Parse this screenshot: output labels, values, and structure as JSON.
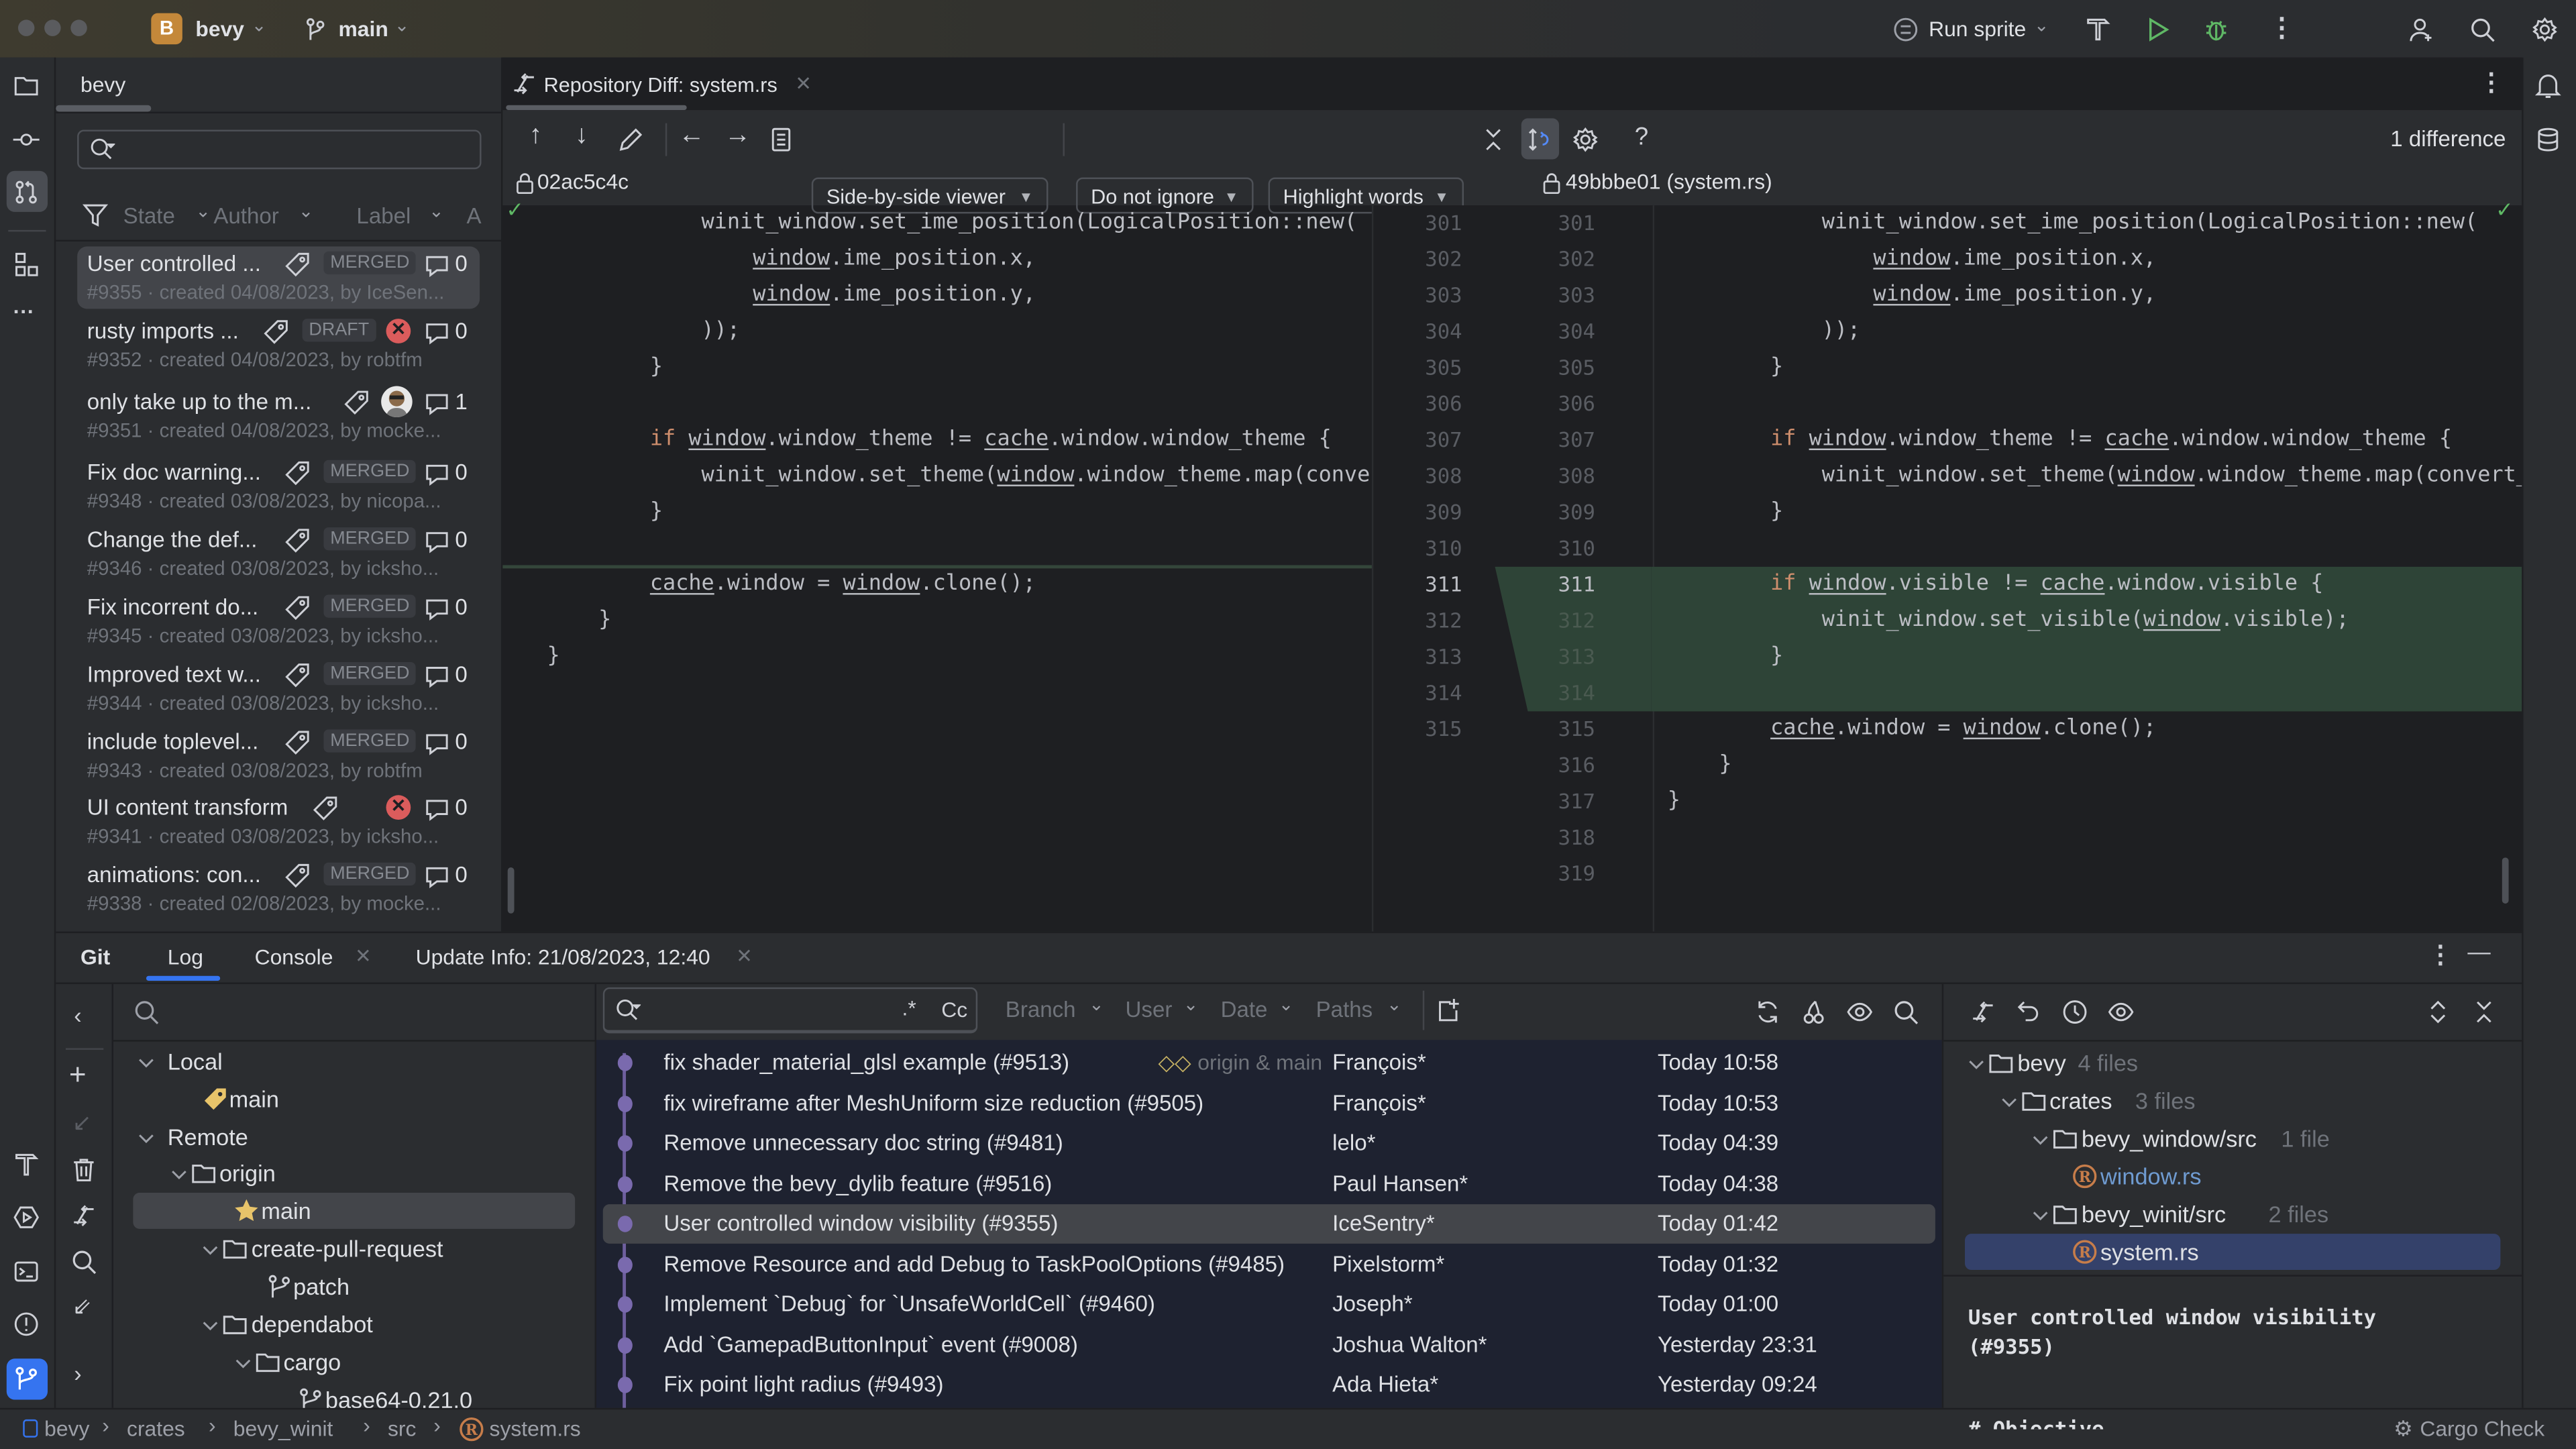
{
  "titlebar": {
    "project_badge": "B",
    "project": "bevy",
    "branch": "main",
    "run_config": "Run sprite"
  },
  "pr_panel": {
    "tab": "bevy",
    "search_placeholder": "",
    "filters": [
      "State",
      "Author",
      "Label",
      "A"
    ],
    "items": [
      {
        "title": "User controlled ...",
        "meta": "#9355 · created 04/08/2023, by IceSen...",
        "state": "MERGED",
        "status": "",
        "comments": "0",
        "selected": true
      },
      {
        "title": "rusty imports ...",
        "meta": "#9352 · created 04/08/2023, by robtfm",
        "state": "DRAFT",
        "status": "failed",
        "comments": "0"
      },
      {
        "title": "only take up to the m...",
        "meta": "#9351 · created 04/08/2023, by mocke...",
        "state": "",
        "status": "avatar",
        "comments": "1"
      },
      {
        "title": "Fix doc warning...",
        "meta": "#9348 · created 03/08/2023, by nicopa...",
        "state": "MERGED",
        "status": "",
        "comments": "0"
      },
      {
        "title": "Change the def...",
        "meta": "#9346 · created 03/08/2023, by icksho...",
        "state": "MERGED",
        "status": "",
        "comments": "0"
      },
      {
        "title": "Fix incorrent do...",
        "meta": "#9345 · created 03/08/2023, by ickshо...",
        "state": "MERGED",
        "status": "",
        "comments": "0"
      },
      {
        "title": "Improved text w...",
        "meta": "#9344 · created 03/08/2023, by ickshо...",
        "state": "MERGED",
        "status": "",
        "comments": "0"
      },
      {
        "title": "include toplevel...",
        "meta": "#9343 · created 03/08/2023, by robtfm",
        "state": "MERGED",
        "status": "",
        "comments": "0"
      },
      {
        "title": "UI content transform",
        "meta": "#9341 · created 03/08/2023, by ickshо...",
        "state": "",
        "status": "failed",
        "comments": "0"
      },
      {
        "title": "animations: con...",
        "meta": "#9338 · created 02/08/2023, by mocke...",
        "state": "MERGED",
        "status": "",
        "comments": "0"
      }
    ]
  },
  "editor": {
    "tab": "Repository Diff: system.rs",
    "viewer": "Side-by-side viewer",
    "ignore": "Do not ignore",
    "highlight": "Highlight words",
    "differences": "1 difference",
    "left_rev": "02ac5c4c",
    "right_rev": "49bbbe01 (system.rs)",
    "left_lines": [
      {
        "n": "301",
        "text": "            winit_window.set_ime_position(LogicalPosition::new("
      },
      {
        "n": "302",
        "text": "                window.ime_position.x,"
      },
      {
        "n": "303",
        "text": "                window.ime_position.y,"
      },
      {
        "n": "304",
        "text": "            ));"
      },
      {
        "n": "305",
        "text": "        }"
      },
      {
        "n": "306",
        "text": ""
      },
      {
        "n": "307",
        "text": "        if window.window_theme != cache.window.window_theme {"
      },
      {
        "n": "308",
        "text": "            winit_window.set_theme(window.window_theme.map(conve"
      },
      {
        "n": "309",
        "text": "        }"
      },
      {
        "n": "310",
        "text": ""
      },
      {
        "n": "311",
        "text": "        cache.window = window.clone();"
      },
      {
        "n": "312",
        "text": "    }"
      },
      {
        "n": "313",
        "text": "}"
      },
      {
        "n": "314",
        "text": ""
      },
      {
        "n": "315",
        "text": ""
      }
    ],
    "right_lines": [
      {
        "n": "301",
        "text": "            winit_window.set_ime_position(LogicalPosition::new("
      },
      {
        "n": "302",
        "text": "                window.ime_position.x,"
      },
      {
        "n": "303",
        "text": "                window.ime_position.y,"
      },
      {
        "n": "304",
        "text": "            ));"
      },
      {
        "n": "305",
        "text": "        }"
      },
      {
        "n": "306",
        "text": ""
      },
      {
        "n": "307",
        "text": "        if window.window_theme != cache.window.window_theme {"
      },
      {
        "n": "308",
        "text": "            winit_window.set_theme(window.window_theme.map(convert_"
      },
      {
        "n": "309",
        "text": "        }"
      },
      {
        "n": "310",
        "text": ""
      },
      {
        "n": "311",
        "text": "        if window.visible != cache.window.visible {",
        "added": true
      },
      {
        "n": "312",
        "text": "            winit_window.set_visible(window.visible);",
        "added": true
      },
      {
        "n": "313",
        "text": "        }",
        "added": true
      },
      {
        "n": "314",
        "text": "",
        "added": true
      },
      {
        "n": "315",
        "text": "        cache.window = window.clone();"
      },
      {
        "n": "316",
        "text": "    }"
      },
      {
        "n": "317",
        "text": "}"
      },
      {
        "n": "318",
        "text": ""
      },
      {
        "n": "319",
        "text": ""
      }
    ]
  },
  "bottom": {
    "title": "Git",
    "tabs": [
      "Log",
      "Console",
      "Update Info: 21/08/2023, 12:40"
    ],
    "active_tab": "Log",
    "branches": [
      {
        "label": "Local",
        "level": 0,
        "type": "group"
      },
      {
        "label": "main",
        "level": 1,
        "type": "local-branch"
      },
      {
        "label": "Remote",
        "level": 0,
        "type": "group"
      },
      {
        "label": "origin",
        "level": 1,
        "type": "folder"
      },
      {
        "label": "main",
        "level": 2,
        "type": "favorite",
        "selected": true
      },
      {
        "label": "create-pull-request",
        "level": 2,
        "type": "folder"
      },
      {
        "label": "patch",
        "level": 3,
        "type": "branch"
      },
      {
        "label": "dependabot",
        "level": 2,
        "type": "folder"
      },
      {
        "label": "cargo",
        "level": 3,
        "type": "folder"
      },
      {
        "label": "base64-0.21.0",
        "level": 4,
        "type": "branch"
      }
    ],
    "log_search": {
      "placeholder": "",
      "regex": ".*",
      "case": "Cc"
    },
    "log_filters": [
      "Branch",
      "User",
      "Date",
      "Paths"
    ],
    "commits": [
      {
        "message": "fix shader_material_glsl example (#9513)",
        "refs": "origin & main",
        "author": "François*",
        "date": "Today 10:58"
      },
      {
        "message": "fix wireframe after MeshUniform size reduction (#9505)",
        "author": "François*",
        "date": "Today 10:53"
      },
      {
        "message": "Remove unnecessary doc string (#9481)",
        "author": "lelo*",
        "date": "Today 04:39"
      },
      {
        "message": "Remove the bevy_dylib feature (#9516)",
        "author": "Paul Hansen*",
        "date": "Today 04:38"
      },
      {
        "message": "User controlled window visibility (#9355)",
        "author": "IceSentry*",
        "date": "Today 01:42",
        "selected": true
      },
      {
        "message": "Remove Resource and add Debug to TaskPoolOptions (#9485)",
        "author": "Pixelstorm*",
        "date": "Today 01:32"
      },
      {
        "message": "Implement `Debug` for `UnsafeWorldCell` (#9460)",
        "author": "Joseph*",
        "date": "Today 01:00"
      },
      {
        "message": "Add `GamepadButtonInput` event (#9008)",
        "author": "Joshua Walton*",
        "date": "Yesterday 23:31"
      },
      {
        "message": "Fix point light radius (#9493)",
        "author": "Ada Hieta*",
        "date": "Yesterday 09:24"
      }
    ],
    "changes": [
      {
        "label": "bevy",
        "count": "4 files",
        "level": 0,
        "type": "folder"
      },
      {
        "label": "crates",
        "count": "3 files",
        "level": 1,
        "type": "folder"
      },
      {
        "label": "bevy_window/src",
        "count": "1 file",
        "level": 2,
        "type": "folder"
      },
      {
        "label": "window.rs",
        "count": "",
        "level": 3,
        "type": "rust-file",
        "modified": true
      },
      {
        "label": "bevy_winit/src",
        "count": "2 files",
        "level": 2,
        "type": "folder"
      },
      {
        "label": "system.rs",
        "count": "",
        "level": 3,
        "type": "rust-file",
        "selected": true
      }
    ],
    "commit_message": [
      "User controlled window visibility",
      "(#9355)",
      "",
      "# Objective"
    ]
  },
  "statusbar": {
    "breadcrumbs": [
      "bevy",
      "crates",
      "bevy_winit",
      "src",
      "system.rs"
    ],
    "cargo_check": "Cargo Check"
  },
  "colors": {
    "accent": "#3574f0",
    "added": "#2e4437",
    "keyword": "#cf8e6d",
    "error": "#db5c5c",
    "run": "#5fb865",
    "branch_tag": "#e8c46a",
    "rust": "#c77d4a",
    "modified_file": "#6f9bd1"
  }
}
